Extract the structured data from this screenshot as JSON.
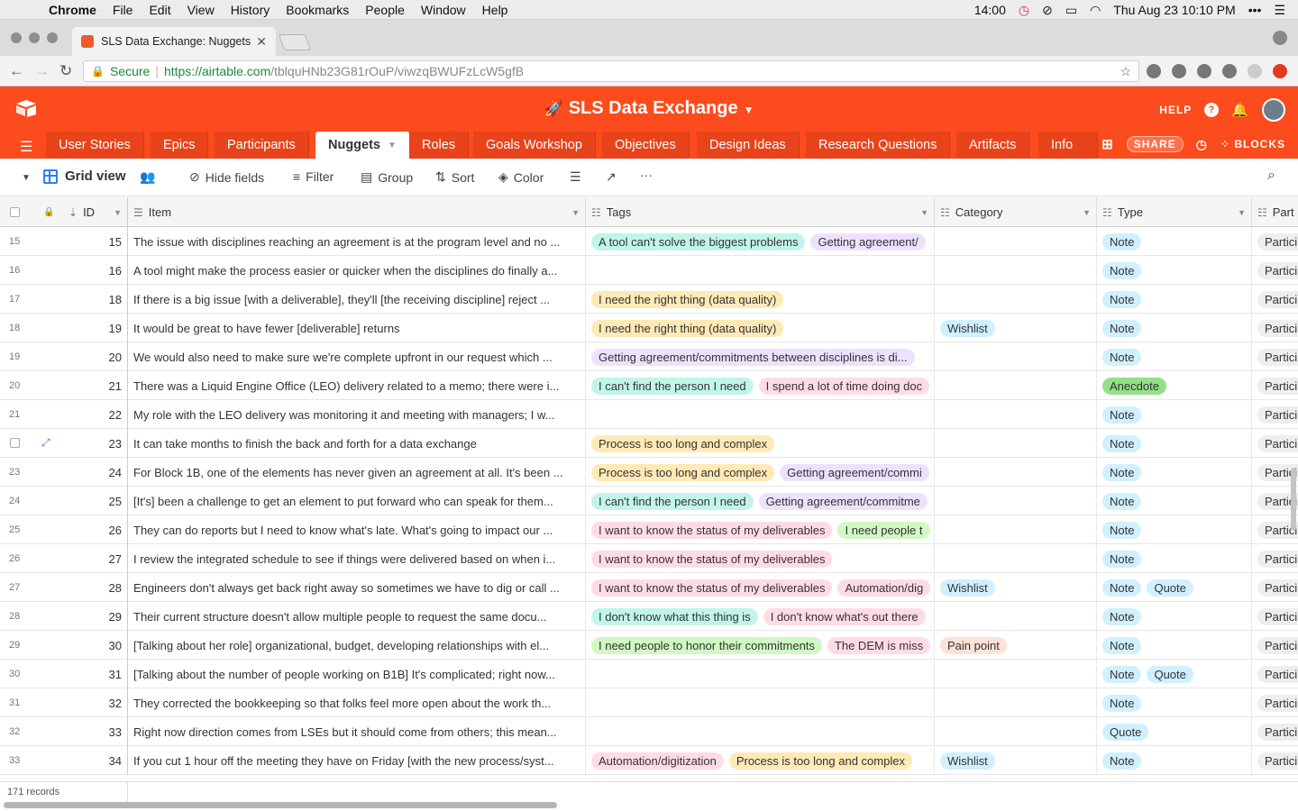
{
  "macos": {
    "app_name": "Chrome",
    "menus": [
      "File",
      "Edit",
      "View",
      "History",
      "Bookmarks",
      "People",
      "Window",
      "Help"
    ],
    "clock_small": "14:00",
    "datetime": "Thu Aug 23  10:10 PM"
  },
  "browser": {
    "tab_title": "SLS Data Exchange: Nuggets",
    "secure_label": "Secure",
    "url_host": "https://airtable.com",
    "url_path": "/tblquHNb23G81rOuP/viwzqBWUFzLcW5gfB"
  },
  "app": {
    "base_title": "SLS Data Exchange",
    "help_label": "HELP",
    "share_label": "SHARE",
    "blocks_label": "BLOCKS",
    "tables": [
      "User Stories",
      "Epics",
      "Participants",
      "Nuggets",
      "Roles",
      "Goals Workshop",
      "Objectives",
      "Design Ideas",
      "Research Questions",
      "Artifacts",
      "Info"
    ],
    "active_table": "Nuggets"
  },
  "viewbar": {
    "view_name": "Grid view",
    "hide_fields": "Hide fields",
    "filter": "Filter",
    "group": "Group",
    "sort": "Sort",
    "color": "Color"
  },
  "columns": {
    "id": "ID",
    "item": "Item",
    "tags": "Tags",
    "category": "Category",
    "type": "Type",
    "participant": "Part"
  },
  "rows": [
    {
      "num": "15",
      "id": "15",
      "item": "The issue with disciplines reaching an agreement is at the program level and no ...",
      "tags": [
        "A tool can't solve the biggest problems",
        "Getting agreement/"
      ],
      "tag_colors": [
        "teal",
        "purple"
      ],
      "category": [],
      "type": [
        "Note"
      ],
      "participant": "Particip"
    },
    {
      "num": "16",
      "id": "16",
      "item": "A tool might make the process easier or quicker when the disciplines do finally a...",
      "tags": [],
      "tag_colors": [],
      "category": [],
      "type": [
        "Note"
      ],
      "participant": "Particip"
    },
    {
      "num": "17",
      "id": "18",
      "item": "If there is a big issue [with a deliverable], they'll [the receiving discipline] reject ...",
      "tags": [
        "I need the right thing (data quality)"
      ],
      "tag_colors": [
        "yellow"
      ],
      "category": [],
      "type": [
        "Note"
      ],
      "participant": "Particip"
    },
    {
      "num": "18",
      "id": "19",
      "item": "It would be great to have fewer [deliverable] returns",
      "tags": [
        "I need the right thing (data quality)"
      ],
      "tag_colors": [
        "yellow"
      ],
      "category": [
        "Wishlist"
      ],
      "type": [
        "Note"
      ],
      "participant": "Particip"
    },
    {
      "num": "19",
      "id": "20",
      "item": "We would also need to make sure we're complete upfront in our request which ...",
      "tags": [
        "Getting agreement/commitments between disciplines is di..."
      ],
      "tag_colors": [
        "purple"
      ],
      "category": [],
      "type": [
        "Note"
      ],
      "participant": "Particip"
    },
    {
      "num": "20",
      "id": "21",
      "item": "There was a Liquid Engine Office (LEO) delivery related to a memo; there were i...",
      "tags": [
        "I can't find the person I need",
        "I spend a lot of time doing doc"
      ],
      "tag_colors": [
        "teal",
        "pink"
      ],
      "category": [],
      "type": [
        "Anecdote"
      ],
      "participant": "Particip"
    },
    {
      "num": "21",
      "id": "22",
      "item": "My role with the LEO delivery was monitoring it and meeting with managers; I w...",
      "tags": [],
      "tag_colors": [],
      "category": [],
      "type": [
        "Note"
      ],
      "participant": "Particip"
    },
    {
      "num": "",
      "id": "23",
      "item": "It can take months to finish the back and forth for a data exchange",
      "tags": [
        "Process is too long and complex"
      ],
      "tag_colors": [
        "yellow"
      ],
      "category": [],
      "type": [
        "Note"
      ],
      "participant": "Particip"
    },
    {
      "num": "23",
      "id": "24",
      "item": "For Block 1B, one of the elements has never given an agreement at all. It's been ...",
      "tags": [
        "Process is too long and complex",
        "Getting agreement/commi"
      ],
      "tag_colors": [
        "yellow",
        "purple"
      ],
      "category": [],
      "type": [
        "Note"
      ],
      "participant": "Particip"
    },
    {
      "num": "24",
      "id": "25",
      "item": "[It's] been a challenge to get an element to put forward who can speak for them...",
      "tags": [
        "I can't find the person I need",
        "Getting agreement/commitme"
      ],
      "tag_colors": [
        "teal",
        "purple"
      ],
      "category": [],
      "type": [
        "Note"
      ],
      "participant": "Particip"
    },
    {
      "num": "25",
      "id": "26",
      "item": "They can do reports but I need to know what's late. What's going to impact our ...",
      "tags": [
        "I want to know the status of my deliverables",
        "I need people t"
      ],
      "tag_colors": [
        "pink",
        "green"
      ],
      "category": [],
      "type": [
        "Note"
      ],
      "participant": "Particip"
    },
    {
      "num": "26",
      "id": "27",
      "item": "I review the integrated schedule to see if things were delivered based on when i...",
      "tags": [
        "I want to know the status of my deliverables"
      ],
      "tag_colors": [
        "pink"
      ],
      "category": [],
      "type": [
        "Note"
      ],
      "participant": "Particip"
    },
    {
      "num": "27",
      "id": "28",
      "item": "Engineers don't always get back right away so sometimes we have to dig or call ...",
      "tags": [
        "I want to know the status of my deliverables",
        "Automation/dig"
      ],
      "tag_colors": [
        "pink",
        "pink"
      ],
      "category": [
        "Wishlist"
      ],
      "type": [
        "Note",
        "Quote"
      ],
      "participant": "Particip"
    },
    {
      "num": "28",
      "id": "29",
      "item": "Their current structure doesn't allow multiple people to request the same docu...",
      "tags": [
        "I don't know what this thing is",
        "I don't know what's out there"
      ],
      "tag_colors": [
        "teal",
        "pink"
      ],
      "category": [],
      "type": [
        "Note"
      ],
      "participant": "Particip"
    },
    {
      "num": "29",
      "id": "30",
      "item": "[Talking about her role] organizational, budget, developing relationships with el...",
      "tags": [
        "I need people to honor their commitments",
        "The DEM is miss"
      ],
      "tag_colors": [
        "green",
        "pink"
      ],
      "category": [
        "Pain point"
      ],
      "type": [
        "Note"
      ],
      "participant": "Particip"
    },
    {
      "num": "30",
      "id": "31",
      "item": "[Talking about the number of people working on B1B] It's complicated; right now...",
      "tags": [],
      "tag_colors": [],
      "category": [],
      "type": [
        "Note",
        "Quote"
      ],
      "participant": "Particip"
    },
    {
      "num": "31",
      "id": "32",
      "item": "They corrected the bookkeeping so that folks feel more open about the work th...",
      "tags": [],
      "tag_colors": [],
      "category": [],
      "type": [
        "Note"
      ],
      "participant": "Particip"
    },
    {
      "num": "32",
      "id": "33",
      "item": "Right now direction comes from LSEs but it should come from others; this mean...",
      "tags": [],
      "tag_colors": [],
      "category": [],
      "type": [
        "Quote"
      ],
      "participant": "Particip"
    },
    {
      "num": "33",
      "id": "34",
      "item": "If you cut 1 hour off the meeting they have on Friday [with the new process/syst...",
      "tags": [
        "Automation/digitization",
        "Process is too long and complex"
      ],
      "tag_colors": [
        "pink",
        "yellow"
      ],
      "category": [
        "Wishlist"
      ],
      "type": [
        "Note"
      ],
      "participant": "Particip"
    }
  ],
  "category_colors": {
    "Wishlist": "blue",
    "Pain point": "orange"
  },
  "type_colors": {
    "Note": "blue",
    "Quote": "blue",
    "Anecdote": "green2"
  },
  "footer": {
    "record_count": "171 records"
  }
}
